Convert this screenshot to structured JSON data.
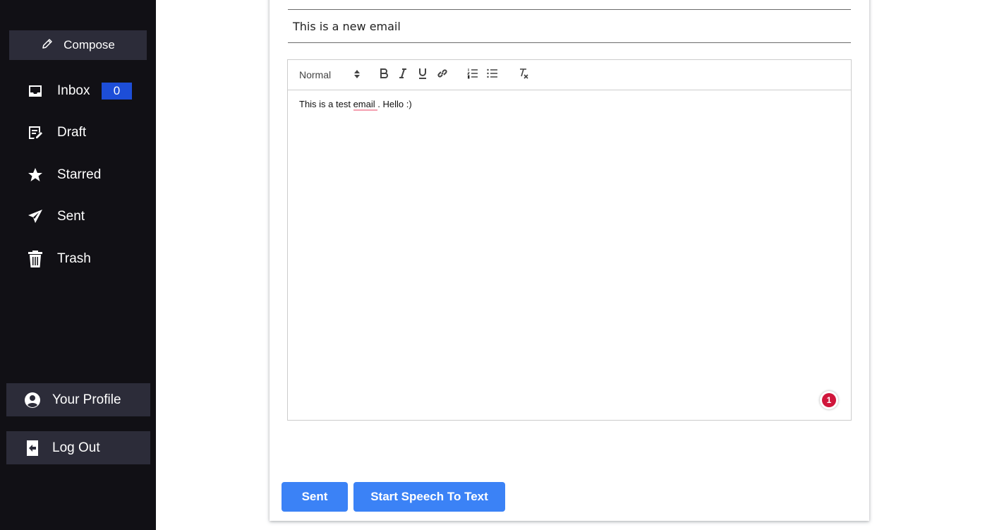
{
  "sidebar": {
    "compose_label": "Compose",
    "items": [
      {
        "label": "Inbox",
        "icon": "inbox-icon",
        "badge": "0"
      },
      {
        "label": "Draft",
        "icon": "draft-icon"
      },
      {
        "label": "Starred",
        "icon": "star-icon"
      },
      {
        "label": "Sent",
        "icon": "send-icon"
      },
      {
        "label": "Trash",
        "icon": "trash-icon"
      }
    ],
    "profile_label": "Your Profile",
    "logout_label": "Log Out"
  },
  "compose": {
    "to_value": "",
    "subject_value": "This is a new email",
    "editor": {
      "header_select": "Normal",
      "body_before": "This is a test ",
      "body_misspelled": "email ",
      "body_after": ". Hello :)"
    },
    "grammarly_count": "1",
    "send_label": "Sent",
    "speech_label": "Start Speech To Text"
  },
  "colors": {
    "sidebar_bg": "#111015",
    "sidebar_button_bg": "#2c2c39",
    "badge_bg": "#1d4ed8",
    "primary_button": "#3b82f6",
    "grammarly_red": "#d0163b"
  }
}
